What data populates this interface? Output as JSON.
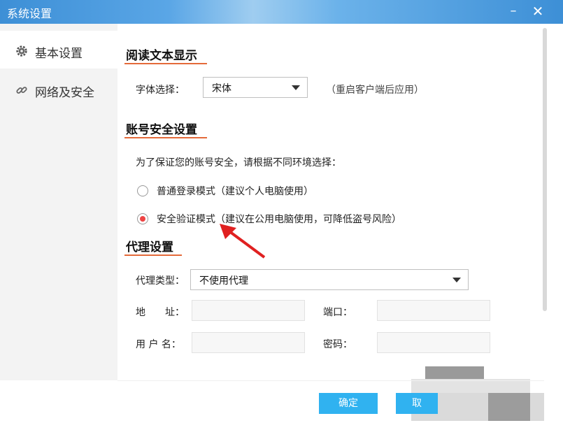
{
  "window": {
    "title": "系统设置",
    "minimize": "–",
    "close": "✕"
  },
  "sidebar": {
    "items": [
      {
        "label": "基本设置",
        "icon": "gear-icon"
      },
      {
        "label": "网络及安全",
        "icon": "link-icon"
      }
    ]
  },
  "reading": {
    "title": "阅读文本显示",
    "font_label": "字体选择：",
    "font_value": "宋体",
    "font_hint": "（重启客户端后应用）"
  },
  "account": {
    "title": "账号安全设置",
    "desc": "为了保证您的账号安全，请根据不同环境选择：",
    "option_normal": "普通登录模式（建议个人电脑使用）",
    "option_secure": "安全验证模式（建议在公用电脑使用，可降低盗号风险）",
    "selected": "secure"
  },
  "proxy": {
    "title": "代理设置",
    "type_label": "代理类型：",
    "type_value": "不使用代理",
    "address_label": "地　　址：",
    "port_label": "端口：",
    "username_label": "用 户 名：",
    "password_label": "密码："
  },
  "footer": {
    "ok_label": "确定",
    "cancel_label": "取"
  },
  "colors": {
    "accent": "#30b2f0",
    "underline": "#e46a3a",
    "arrow": "#e02020",
    "radio_selected": "#e44444"
  }
}
